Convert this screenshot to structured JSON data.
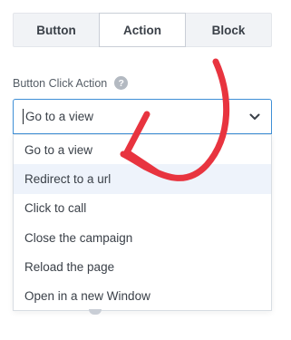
{
  "tabs": [
    {
      "label": "Button",
      "active": false
    },
    {
      "label": "Action",
      "active": true
    },
    {
      "label": "Block",
      "active": false
    }
  ],
  "field": {
    "label": "Button Click Action",
    "help_icon": "question-mark-icon"
  },
  "select": {
    "value": "Go to a view",
    "chevron_icon": "chevron-down-icon"
  },
  "options": [
    "Go to a view",
    "Redirect to a url",
    "Click to call",
    "Close the campaign",
    "Reload the page",
    "Open in a new Window"
  ],
  "highlighted_option": "Redirect to a url",
  "annotation": {
    "icon": "red-hand-drawn-arrow-icon",
    "color": "#e8343f",
    "points_to": "Redirect to a url"
  },
  "colors": {
    "focus_border": "#3f8fd6",
    "hover_background": "#eef3fb",
    "tab_background": "#f1f3f6"
  }
}
